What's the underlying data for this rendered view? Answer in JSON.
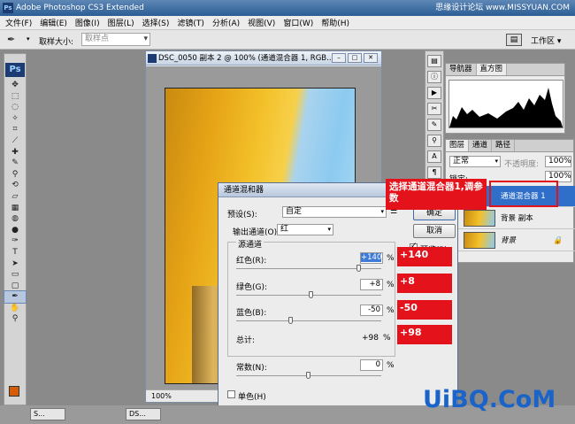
{
  "app": {
    "title": "Adobe Photoshop CS3 Extended",
    "watermark": "思缘设计论坛 www.MISSYUAN.COM"
  },
  "menu": [
    "文件(F)",
    "编辑(E)",
    "图像(I)",
    "图层(L)",
    "选择(S)",
    "滤镜(T)",
    "分析(A)",
    "视图(V)",
    "窗口(W)",
    "帮助(H)"
  ],
  "options": {
    "sample_size_label": "取样大小:",
    "sample_value": "取样点",
    "workspace": "工作区 ▾"
  },
  "toolbox": {
    "logo": "Ps"
  },
  "document": {
    "title": "DSC_0050 副本 2 @ 100% (通道混合器 1, RGB...",
    "zoom": "100%"
  },
  "dialog": {
    "title": "通道混和器",
    "preset_label": "预设(S):",
    "preset_value": "自定",
    "output_label": "输出通道(O):",
    "output_value": "红",
    "group_label": "源通道",
    "red_label": "红色(R):",
    "red_value": "+140",
    "green_label": "绿色(G):",
    "green_value": "+8",
    "blue_label": "蓝色(B):",
    "blue_value": "-50",
    "total_label": "总计:",
    "total_value": "+98",
    "constant_label": "常数(N):",
    "constant_value": "0",
    "percent": "%",
    "mono_label": "单色(H)",
    "ok": "确定",
    "cancel": "取消",
    "preview": "预览(P)",
    "red": 140,
    "green": 8,
    "blue": -50,
    "constant": 0
  },
  "annotations": {
    "callout": "选择通道混合器1,调参数",
    "red": "+140",
    "green": "+8",
    "blue": "-50",
    "total": "+98"
  },
  "panels": {
    "nav_tab": "导航器",
    "hist_tab": "直方图",
    "layers_tab": "图层",
    "channels_tab": "通道",
    "paths_tab": "路径",
    "blend_mode": "正常",
    "opacity_label": "不透明度:",
    "opacity_value": "100%",
    "lock_label": "锁定:",
    "fill_value": "100%",
    "layer_adj": "通道混合器 1",
    "layer_copy": "背景 副本",
    "layer_bg": "背景"
  },
  "taskbar": [
    "S...",
    "DS..."
  ],
  "site_logo": "UiBQ.CoM",
  "colors": {
    "accent_red": "#e3121b",
    "foreground": "#d55b05"
  }
}
